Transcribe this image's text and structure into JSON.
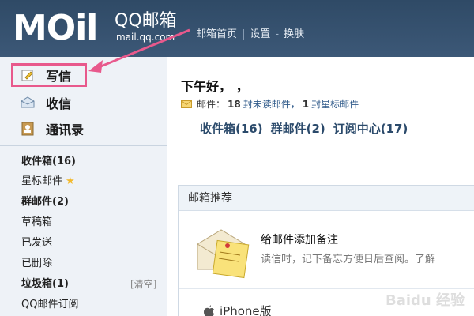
{
  "header": {
    "logo_main": "MOil",
    "logo_brand": "QQ邮箱",
    "logo_domain": "mail.qq.com",
    "nav": [
      "邮箱首页",
      "设置",
      "换肤"
    ]
  },
  "sidebar": {
    "actions": [
      {
        "label": "写信",
        "icon": "pencil-icon"
      },
      {
        "label": "收信",
        "icon": "inbox-icon"
      },
      {
        "label": "通讯录",
        "icon": "contacts-icon"
      }
    ],
    "folders": [
      {
        "label": "收件箱(16)",
        "bold": true
      },
      {
        "label": "星标邮件",
        "bold": false,
        "star": "★"
      },
      {
        "label": "群邮件(2)",
        "bold": true
      },
      {
        "label": "草稿箱",
        "bold": false
      },
      {
        "label": "已发送",
        "bold": false
      },
      {
        "label": "已删除",
        "bold": false
      },
      {
        "label": "垃圾箱(1)",
        "bold": true,
        "extra": "[清空]"
      },
      {
        "label": "QQ邮件订阅",
        "bold": false
      }
    ]
  },
  "main": {
    "greeting": "下午好，        ，",
    "mail_prefix": "邮件：",
    "unread_count": "18",
    "unread_label": "封未读邮件，",
    "star_count": "1",
    "star_label": "封星标邮件",
    "quicklinks": [
      "收件箱(16)",
      "群邮件(2)",
      "订阅中心(17)"
    ],
    "panel": {
      "title": "邮箱推荐",
      "note_title": "给邮件添加备注",
      "note_desc": "读信时，记下备忘方便日后查阅。了解",
      "iphone_label": "iPhone版"
    }
  },
  "watermark": "Baidu 经验",
  "colors": {
    "header_bg": "#2f4a66",
    "sidebar_bg": "#eef2f7",
    "highlight": "#e8598c",
    "link": "#2f5a8a"
  }
}
